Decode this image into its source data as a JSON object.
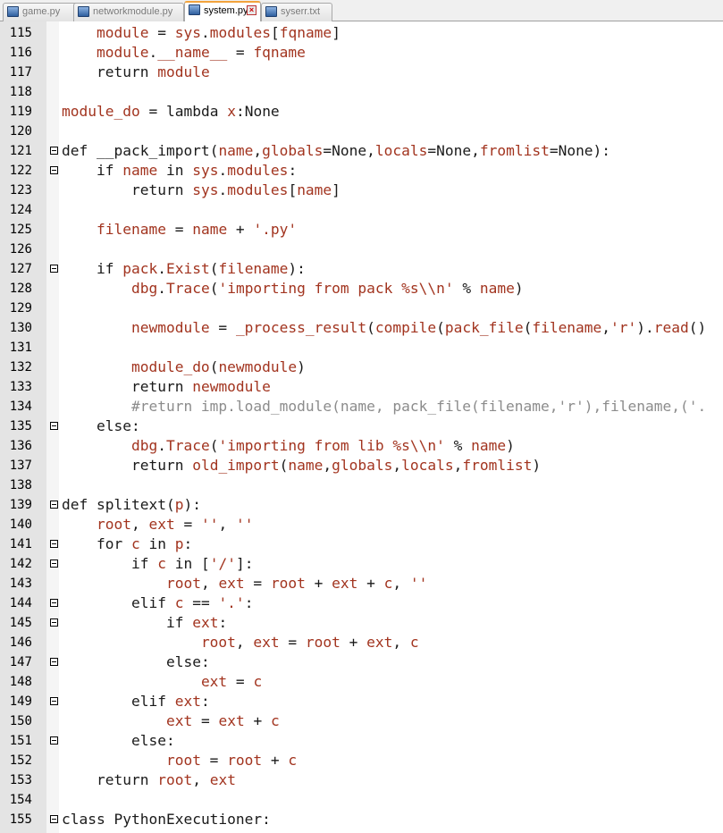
{
  "tabs": [
    {
      "label": "game.py",
      "active": false,
      "has_close": false
    },
    {
      "label": "networkmodule.py",
      "active": false,
      "has_close": false
    },
    {
      "label": "system.py",
      "active": true,
      "has_close": true
    },
    {
      "label": "syserr.txt",
      "active": false,
      "has_close": false
    }
  ],
  "colors": {
    "keyword": "#1a1a1a",
    "identifier": "#a2341f",
    "string": "#a2341f",
    "comment": "#8c8c8c",
    "gutter_bg": "#e4e4e4",
    "active_tab_accent": "#f2a33c"
  },
  "lines": [
    {
      "num": "115",
      "fold": false,
      "tokens": [
        [
          "o",
          "    "
        ],
        [
          "i",
          "module"
        ],
        [
          "o",
          " = "
        ],
        [
          "i",
          "sys"
        ],
        [
          "o",
          "."
        ],
        [
          "i",
          "modules"
        ],
        [
          "o",
          "["
        ],
        [
          "i",
          "fqname"
        ],
        [
          "o",
          "]"
        ]
      ]
    },
    {
      "num": "116",
      "fold": false,
      "tokens": [
        [
          "o",
          "    "
        ],
        [
          "i",
          "module"
        ],
        [
          "o",
          "."
        ],
        [
          "i",
          "__name__"
        ],
        [
          "o",
          " = "
        ],
        [
          "i",
          "fqname"
        ]
      ]
    },
    {
      "num": "117",
      "fold": false,
      "tokens": [
        [
          "o",
          "    "
        ],
        [
          "k",
          "return "
        ],
        [
          "i",
          "module"
        ]
      ]
    },
    {
      "num": "118",
      "fold": false,
      "tokens": []
    },
    {
      "num": "119",
      "fold": false,
      "tokens": [
        [
          "i",
          "module_do"
        ],
        [
          "o",
          " = "
        ],
        [
          "k",
          "lambda "
        ],
        [
          "i",
          "x"
        ],
        [
          "o",
          ":None"
        ]
      ]
    },
    {
      "num": "120",
      "fold": false,
      "tokens": []
    },
    {
      "num": "121",
      "fold": true,
      "tokens": [
        [
          "k",
          "def "
        ],
        [
          "k",
          "__pack_import"
        ],
        [
          "o",
          "("
        ],
        [
          "i",
          "name"
        ],
        [
          "o",
          ","
        ],
        [
          "i",
          "globals"
        ],
        [
          "o",
          "=None,"
        ],
        [
          "i",
          "locals"
        ],
        [
          "o",
          "=None,"
        ],
        [
          "i",
          "fromlist"
        ],
        [
          "o",
          "=None):"
        ]
      ]
    },
    {
      "num": "122",
      "fold": true,
      "tokens": [
        [
          "o",
          "    "
        ],
        [
          "k",
          "if "
        ],
        [
          "i",
          "name"
        ],
        [
          "k",
          " in "
        ],
        [
          "i",
          "sys"
        ],
        [
          "o",
          "."
        ],
        [
          "i",
          "modules"
        ],
        [
          "o",
          ":"
        ]
      ]
    },
    {
      "num": "123",
      "fold": false,
      "tokens": [
        [
          "o",
          "        "
        ],
        [
          "k",
          "return "
        ],
        [
          "i",
          "sys"
        ],
        [
          "o",
          "."
        ],
        [
          "i",
          "modules"
        ],
        [
          "o",
          "["
        ],
        [
          "i",
          "name"
        ],
        [
          "o",
          "]"
        ]
      ]
    },
    {
      "num": "124",
      "fold": false,
      "tokens": []
    },
    {
      "num": "125",
      "fold": false,
      "tokens": [
        [
          "o",
          "    "
        ],
        [
          "i",
          "filename"
        ],
        [
          "o",
          " = "
        ],
        [
          "i",
          "name"
        ],
        [
          "o",
          " + "
        ],
        [
          "s",
          "'.py'"
        ]
      ]
    },
    {
      "num": "126",
      "fold": false,
      "tokens": []
    },
    {
      "num": "127",
      "fold": true,
      "tokens": [
        [
          "o",
          "    "
        ],
        [
          "k",
          "if "
        ],
        [
          "i",
          "pack"
        ],
        [
          "o",
          "."
        ],
        [
          "i",
          "Exist"
        ],
        [
          "o",
          "("
        ],
        [
          "i",
          "filename"
        ],
        [
          "o",
          "):"
        ]
      ]
    },
    {
      "num": "128",
      "fold": false,
      "tokens": [
        [
          "o",
          "        "
        ],
        [
          "i",
          "dbg"
        ],
        [
          "o",
          "."
        ],
        [
          "i",
          "Trace"
        ],
        [
          "o",
          "("
        ],
        [
          "s",
          "'importing from pack %s\\\\n'"
        ],
        [
          "o",
          " % "
        ],
        [
          "i",
          "name"
        ],
        [
          "o",
          ")"
        ]
      ]
    },
    {
      "num": "129",
      "fold": false,
      "tokens": []
    },
    {
      "num": "130",
      "fold": false,
      "tokens": [
        [
          "o",
          "        "
        ],
        [
          "i",
          "newmodule"
        ],
        [
          "o",
          " = "
        ],
        [
          "i",
          "_process_result"
        ],
        [
          "o",
          "("
        ],
        [
          "i",
          "compile"
        ],
        [
          "o",
          "("
        ],
        [
          "i",
          "pack_file"
        ],
        [
          "o",
          "("
        ],
        [
          "i",
          "filename"
        ],
        [
          "o",
          ","
        ],
        [
          "s",
          "'r'"
        ],
        [
          "o",
          ")."
        ],
        [
          "i",
          "read"
        ],
        [
          "o",
          "()"
        ]
      ]
    },
    {
      "num": "131",
      "fold": false,
      "tokens": []
    },
    {
      "num": "132",
      "fold": false,
      "tokens": [
        [
          "o",
          "        "
        ],
        [
          "i",
          "module_do"
        ],
        [
          "o",
          "("
        ],
        [
          "i",
          "newmodule"
        ],
        [
          "o",
          ")"
        ]
      ]
    },
    {
      "num": "133",
      "fold": false,
      "tokens": [
        [
          "o",
          "        "
        ],
        [
          "k",
          "return "
        ],
        [
          "i",
          "newmodule"
        ]
      ]
    },
    {
      "num": "134",
      "fold": false,
      "tokens": [
        [
          "o",
          "        "
        ],
        [
          "c",
          "#return imp.load_module(name, pack_file(filename,'r'),filename,('."
        ]
      ]
    },
    {
      "num": "135",
      "fold": true,
      "tokens": [
        [
          "o",
          "    "
        ],
        [
          "k",
          "else"
        ],
        [
          "o",
          ":"
        ]
      ]
    },
    {
      "num": "136",
      "fold": false,
      "tokens": [
        [
          "o",
          "        "
        ],
        [
          "i",
          "dbg"
        ],
        [
          "o",
          "."
        ],
        [
          "i",
          "Trace"
        ],
        [
          "o",
          "("
        ],
        [
          "s",
          "'importing from lib %s\\\\n'"
        ],
        [
          "o",
          " % "
        ],
        [
          "i",
          "name"
        ],
        [
          "o",
          ")"
        ]
      ]
    },
    {
      "num": "137",
      "fold": false,
      "tokens": [
        [
          "o",
          "        "
        ],
        [
          "k",
          "return "
        ],
        [
          "i",
          "old_import"
        ],
        [
          "o",
          "("
        ],
        [
          "i",
          "name"
        ],
        [
          "o",
          ","
        ],
        [
          "i",
          "globals"
        ],
        [
          "o",
          ","
        ],
        [
          "i",
          "locals"
        ],
        [
          "o",
          ","
        ],
        [
          "i",
          "fromlist"
        ],
        [
          "o",
          ")"
        ]
      ]
    },
    {
      "num": "138",
      "fold": false,
      "tokens": []
    },
    {
      "num": "139",
      "fold": true,
      "tokens": [
        [
          "k",
          "def "
        ],
        [
          "k",
          "splitext"
        ],
        [
          "o",
          "("
        ],
        [
          "i",
          "p"
        ],
        [
          "o",
          "):"
        ]
      ]
    },
    {
      "num": "140",
      "fold": false,
      "tokens": [
        [
          "o",
          "    "
        ],
        [
          "i",
          "root"
        ],
        [
          "o",
          ", "
        ],
        [
          "i",
          "ext"
        ],
        [
          "o",
          " = "
        ],
        [
          "s",
          "''"
        ],
        [
          "o",
          ", "
        ],
        [
          "s",
          "''"
        ]
      ]
    },
    {
      "num": "141",
      "fold": true,
      "tokens": [
        [
          "o",
          "    "
        ],
        [
          "k",
          "for "
        ],
        [
          "i",
          "c"
        ],
        [
          "k",
          " in "
        ],
        [
          "i",
          "p"
        ],
        [
          "o",
          ":"
        ]
      ]
    },
    {
      "num": "142",
      "fold": true,
      "tokens": [
        [
          "o",
          "        "
        ],
        [
          "k",
          "if "
        ],
        [
          "i",
          "c"
        ],
        [
          "k",
          " in "
        ],
        [
          "o",
          "["
        ],
        [
          "s",
          "'/'"
        ],
        [
          "o",
          "]:"
        ]
      ]
    },
    {
      "num": "143",
      "fold": false,
      "tokens": [
        [
          "o",
          "            "
        ],
        [
          "i",
          "root"
        ],
        [
          "o",
          ", "
        ],
        [
          "i",
          "ext"
        ],
        [
          "o",
          " = "
        ],
        [
          "i",
          "root"
        ],
        [
          "o",
          " + "
        ],
        [
          "i",
          "ext"
        ],
        [
          "o",
          " + "
        ],
        [
          "i",
          "c"
        ],
        [
          "o",
          ", "
        ],
        [
          "s",
          "''"
        ]
      ]
    },
    {
      "num": "144",
      "fold": true,
      "tokens": [
        [
          "o",
          "        "
        ],
        [
          "k",
          "elif "
        ],
        [
          "i",
          "c"
        ],
        [
          "o",
          " == "
        ],
        [
          "s",
          "'.'"
        ],
        [
          "o",
          ":"
        ]
      ]
    },
    {
      "num": "145",
      "fold": true,
      "tokens": [
        [
          "o",
          "            "
        ],
        [
          "k",
          "if "
        ],
        [
          "i",
          "ext"
        ],
        [
          "o",
          ":"
        ]
      ]
    },
    {
      "num": "146",
      "fold": false,
      "tokens": [
        [
          "o",
          "                "
        ],
        [
          "i",
          "root"
        ],
        [
          "o",
          ", "
        ],
        [
          "i",
          "ext"
        ],
        [
          "o",
          " = "
        ],
        [
          "i",
          "root"
        ],
        [
          "o",
          " + "
        ],
        [
          "i",
          "ext"
        ],
        [
          "o",
          ", "
        ],
        [
          "i",
          "c"
        ]
      ]
    },
    {
      "num": "147",
      "fold": true,
      "tokens": [
        [
          "o",
          "            "
        ],
        [
          "k",
          "else"
        ],
        [
          "o",
          ":"
        ]
      ]
    },
    {
      "num": "148",
      "fold": false,
      "tokens": [
        [
          "o",
          "                "
        ],
        [
          "i",
          "ext"
        ],
        [
          "o",
          " = "
        ],
        [
          "i",
          "c"
        ]
      ]
    },
    {
      "num": "149",
      "fold": true,
      "tokens": [
        [
          "o",
          "        "
        ],
        [
          "k",
          "elif "
        ],
        [
          "i",
          "ext"
        ],
        [
          "o",
          ":"
        ]
      ]
    },
    {
      "num": "150",
      "fold": false,
      "tokens": [
        [
          "o",
          "            "
        ],
        [
          "i",
          "ext"
        ],
        [
          "o",
          " = "
        ],
        [
          "i",
          "ext"
        ],
        [
          "o",
          " + "
        ],
        [
          "i",
          "c"
        ]
      ]
    },
    {
      "num": "151",
      "fold": true,
      "tokens": [
        [
          "o",
          "        "
        ],
        [
          "k",
          "else"
        ],
        [
          "o",
          ":"
        ]
      ]
    },
    {
      "num": "152",
      "fold": false,
      "tokens": [
        [
          "o",
          "            "
        ],
        [
          "i",
          "root"
        ],
        [
          "o",
          " = "
        ],
        [
          "i",
          "root"
        ],
        [
          "o",
          " + "
        ],
        [
          "i",
          "c"
        ]
      ]
    },
    {
      "num": "153",
      "fold": false,
      "tokens": [
        [
          "o",
          "    "
        ],
        [
          "k",
          "return "
        ],
        [
          "i",
          "root"
        ],
        [
          "o",
          ", "
        ],
        [
          "i",
          "ext"
        ]
      ]
    },
    {
      "num": "154",
      "fold": false,
      "tokens": []
    },
    {
      "num": "155",
      "fold": true,
      "tokens": [
        [
          "k",
          "class "
        ],
        [
          "k",
          "PythonExecutioner"
        ],
        [
          "o",
          ":"
        ]
      ]
    }
  ]
}
